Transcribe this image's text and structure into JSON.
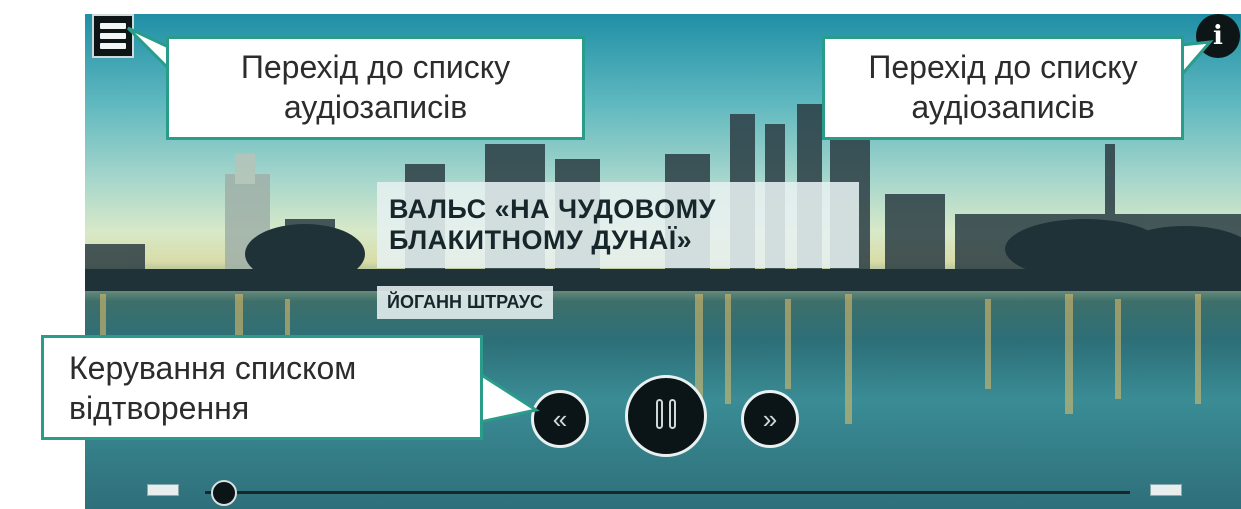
{
  "player": {
    "title": "ВАЛЬС «НА ЧУДОВОМУ БЛАКИТНОМУ ДУНАЇ»",
    "artist": "ЙОГАНН ШТРАУС",
    "progress_fraction": 0.02
  },
  "callouts": {
    "top_left": "Перехід до списку аудіозаписів",
    "top_right": "Перехід до списку аудіозаписів",
    "bottom_left": "Керування списком відтворення"
  },
  "colors": {
    "callout_border": "#2a9c8a",
    "control_bg": "#0b1416"
  },
  "icons": {
    "menu": "menu-icon",
    "info": "info-icon",
    "prev": "previous-icon",
    "play": "pause-icon",
    "next": "next-icon"
  }
}
